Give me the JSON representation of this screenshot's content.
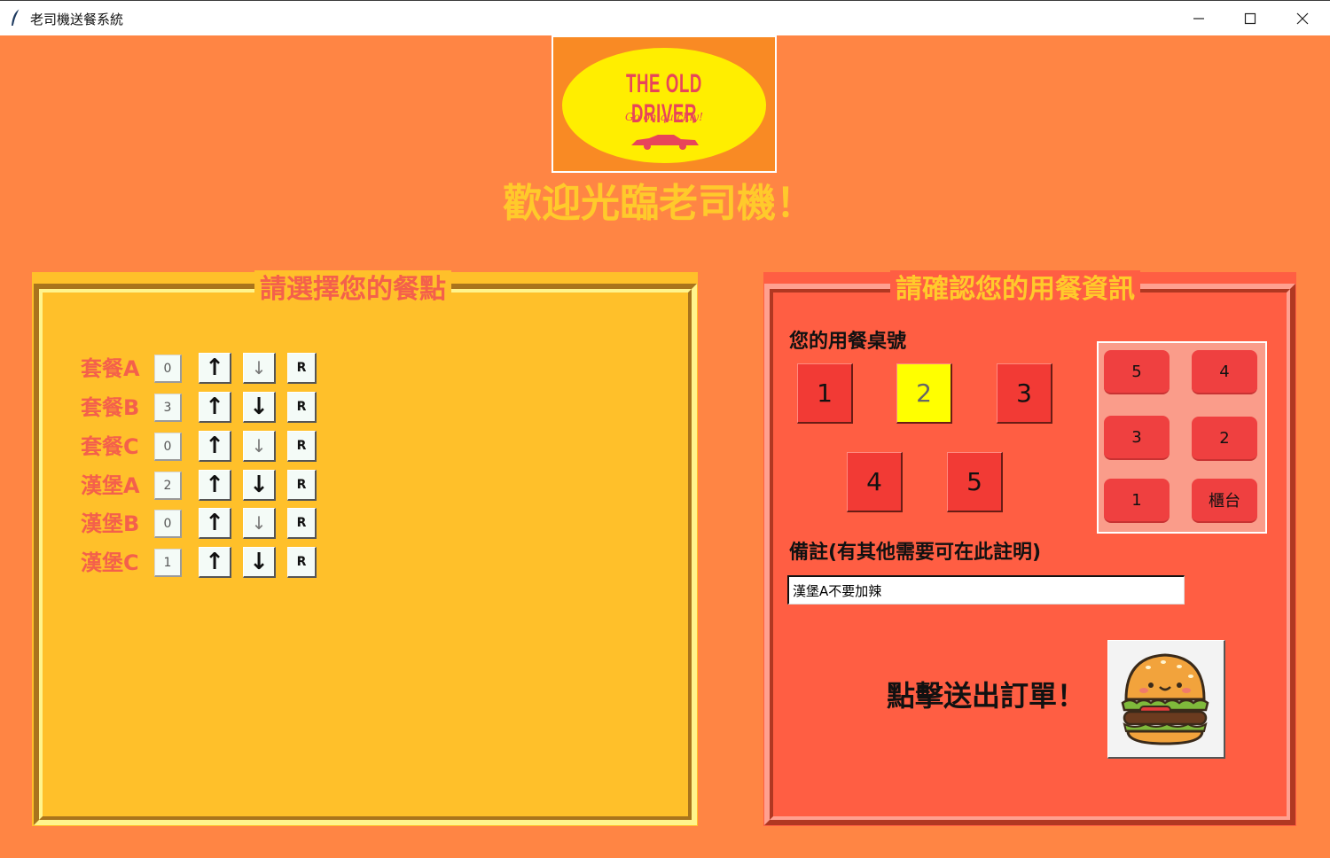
{
  "window": {
    "title": "老司機送餐系統",
    "minimize_icon": "minimize-icon",
    "maximize_icon": "maximize-icon",
    "close_icon": "close-icon"
  },
  "header": {
    "logo_title": "THE OLD DRIVER",
    "logo_subtitle": "Go on quickly!",
    "welcome": "歡迎光臨老司機！"
  },
  "menu_panel": {
    "title": "請選擇您的餐點",
    "items": [
      {
        "label": "套餐A",
        "qty": "0",
        "up": "↑",
        "down": "↓",
        "reset": "R",
        "down_enabled": false
      },
      {
        "label": "套餐B",
        "qty": "3",
        "up": "↑",
        "down": "↓",
        "reset": "R",
        "down_enabled": true
      },
      {
        "label": "套餐C",
        "qty": "0",
        "up": "↑",
        "down": "↓",
        "reset": "R",
        "down_enabled": false
      },
      {
        "label": "漢堡A",
        "qty": "2",
        "up": "↑",
        "down": "↓",
        "reset": "R",
        "down_enabled": true
      },
      {
        "label": "漢堡B",
        "qty": "0",
        "up": "↑",
        "down": "↓",
        "reset": "R",
        "down_enabled": false
      },
      {
        "label": "漢堡C",
        "qty": "1",
        "up": "↑",
        "down": "↓",
        "reset": "R",
        "down_enabled": true
      }
    ]
  },
  "info_panel": {
    "title": "請確認您的用餐資訊",
    "table_label": "您的用餐桌號",
    "tables": [
      "1",
      "2",
      "3",
      "4",
      "5"
    ],
    "selected_table": "2",
    "map": [
      "5",
      "4",
      "3",
      "2",
      "1",
      "櫃台"
    ],
    "note_label": "備註(有其他需要可在此註明)",
    "note_value": "漢堡A不要加辣",
    "submit_label": "點擊送出訂單！",
    "submit_icon": "hamburger-icon"
  },
  "colors": {
    "background": "#ff8544",
    "menu_panel": "#ffc02a",
    "info_panel": "#ff5e43",
    "accent_yellow": "#ffca2b",
    "accent_red": "#f4604b",
    "selected_table": "#ffff00"
  }
}
